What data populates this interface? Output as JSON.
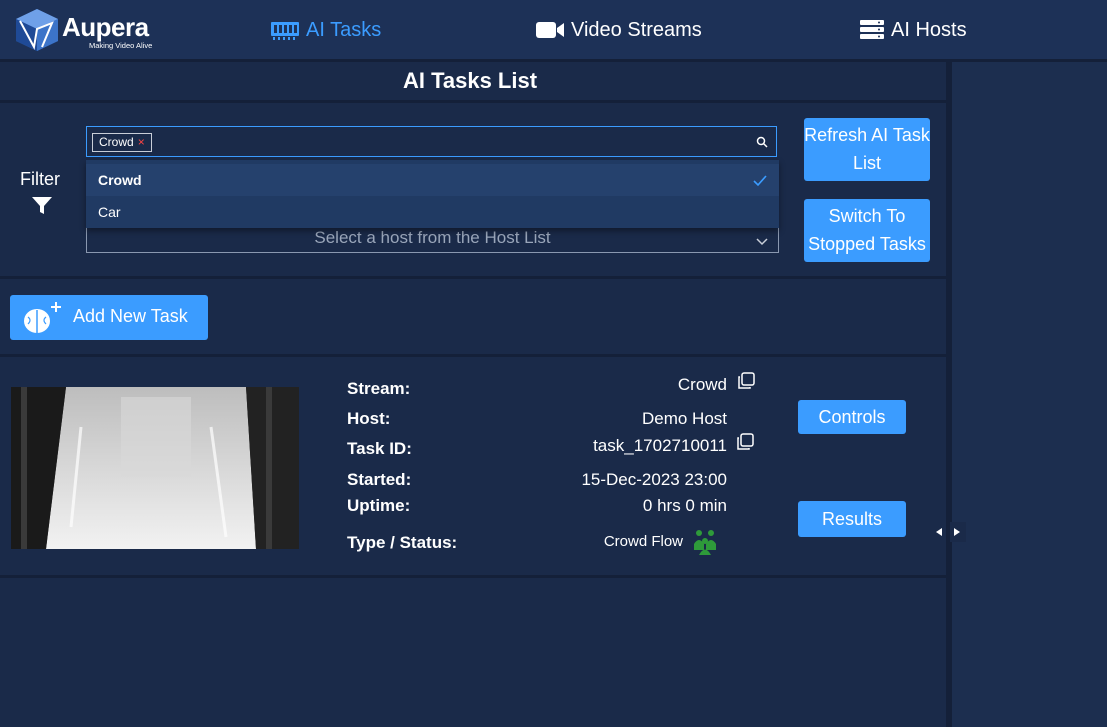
{
  "brand": {
    "name": "Aupera",
    "tagline": "Making Video Alive"
  },
  "nav": [
    {
      "label": "AI Tasks",
      "icon": "gpu-card-icon",
      "active": true
    },
    {
      "label": "Video Streams",
      "icon": "video-camera-icon",
      "active": false
    },
    {
      "label": "AI Hosts",
      "icon": "server-rack-icon",
      "active": false
    }
  ],
  "page_title": "AI Tasks List",
  "filter": {
    "label": "Filter",
    "selected_chip": "Crowd",
    "options": [
      {
        "label": "Crowd",
        "selected": true
      },
      {
        "label": "Car",
        "selected": false
      }
    ],
    "host_placeholder": "Select a host from the Host List"
  },
  "buttons": {
    "refresh": "Refresh AI Task List",
    "switch": "Switch To Stopped Tasks",
    "add_task": "Add New Task",
    "controls": "Controls",
    "results": "Results"
  },
  "task": {
    "labels": {
      "stream": "Stream:",
      "host": "Host:",
      "task_id": "Task ID:",
      "started": "Started:",
      "uptime": "Uptime:",
      "type_status": "Type / Status:"
    },
    "values": {
      "stream": "Crowd",
      "host": "Demo Host",
      "task_id": "task_1702710011",
      "started": "15-Dec-2023 23:00",
      "uptime": "0 hrs 0 min",
      "type": "Crowd Flow"
    },
    "status_color": "#2e9a3a"
  },
  "colors": {
    "accent": "#3b9cff",
    "background": "#1a2a49",
    "header": "#1d3157"
  }
}
